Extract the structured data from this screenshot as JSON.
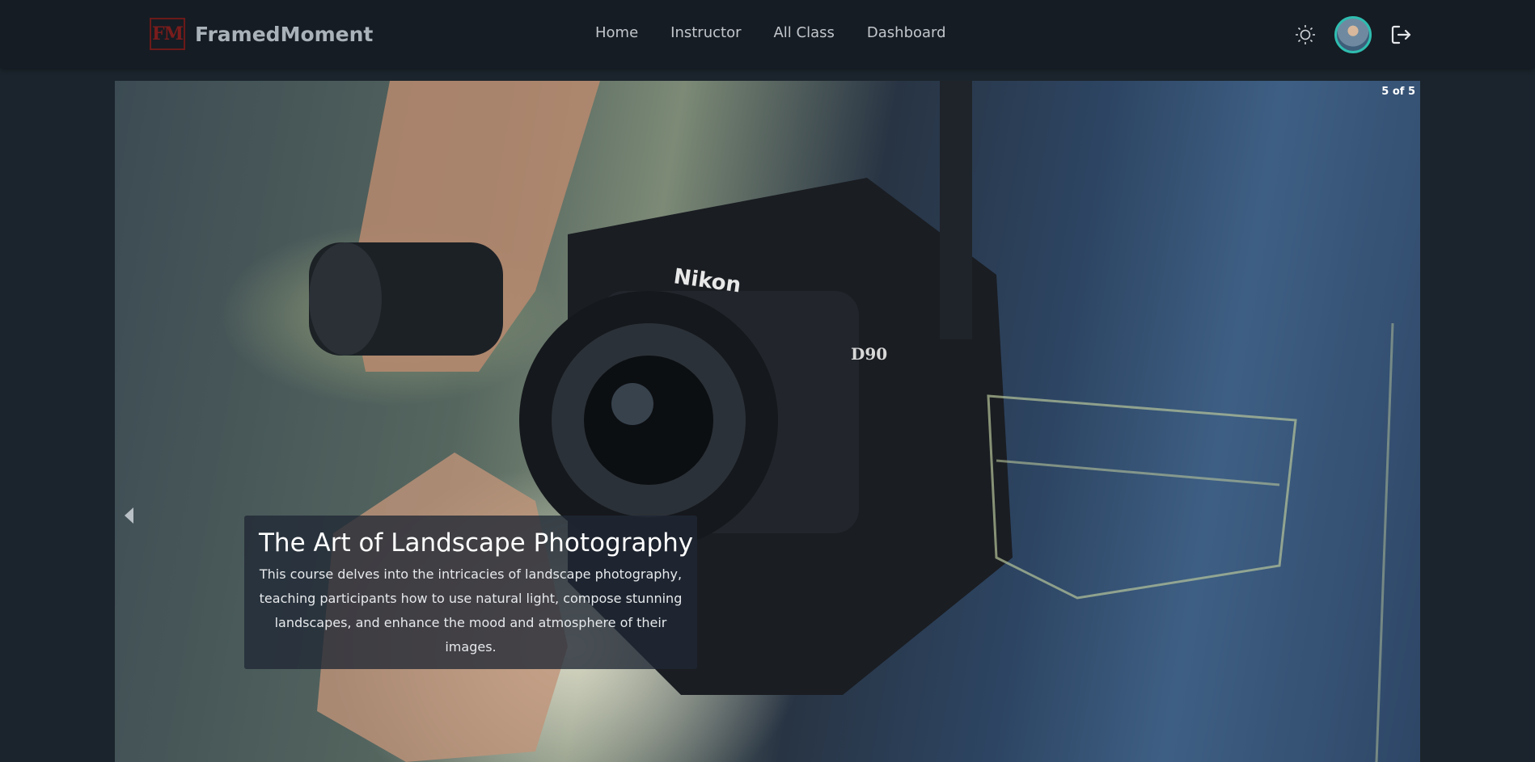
{
  "brand": {
    "logo_text": "FM",
    "name": "FramedMoment",
    "logo_color": "#7a1c1c"
  },
  "nav": {
    "links": [
      "Home",
      "Instructor",
      "All Class",
      "Dashboard"
    ]
  },
  "header_icons": {
    "theme_toggle": "sun-icon",
    "avatar": "user-avatar",
    "logout": "logout-icon",
    "avatar_ring_color": "#2fbdb0"
  },
  "carousel": {
    "counter": "5 of 5",
    "image": "nikon-d90-camera-photo",
    "caption": {
      "title": "The Art of Landscape Photography",
      "description": "This course delves into the intricacies of landscape photography, teaching participants how to use natural light, compose stunning landscapes, and enhance the mood and atmosphere of their images."
    }
  }
}
